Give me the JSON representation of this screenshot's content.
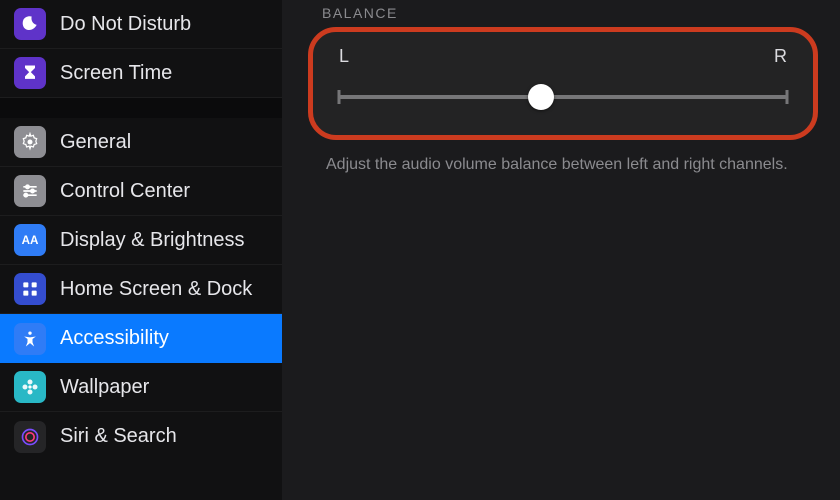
{
  "sidebar": {
    "items": [
      {
        "label": "Do Not Disturb",
        "iconBg": "#5f33c9"
      },
      {
        "label": "Screen Time",
        "iconBg": "#5f33c9"
      },
      {
        "label": "General",
        "iconBg": "#8e8e93"
      },
      {
        "label": "Control Center",
        "iconBg": "#8e8e93"
      },
      {
        "label": "Display & Brightness",
        "iconBg": "#2f7cf6"
      },
      {
        "label": "Home Screen & Dock",
        "iconBg": "#344dcf"
      },
      {
        "label": "Accessibility",
        "iconBg": "#2f7cf6",
        "selected": true
      },
      {
        "label": "Wallpaper",
        "iconBg": "#29b8c6"
      },
      {
        "label": "Siri & Search",
        "iconBg": "#252527"
      }
    ]
  },
  "detail": {
    "section_title": "BALANCE",
    "left_label": "L",
    "right_label": "R",
    "description": "Adjust the audio volume balance between left and right channels.",
    "slider_value_percent": 45
  }
}
